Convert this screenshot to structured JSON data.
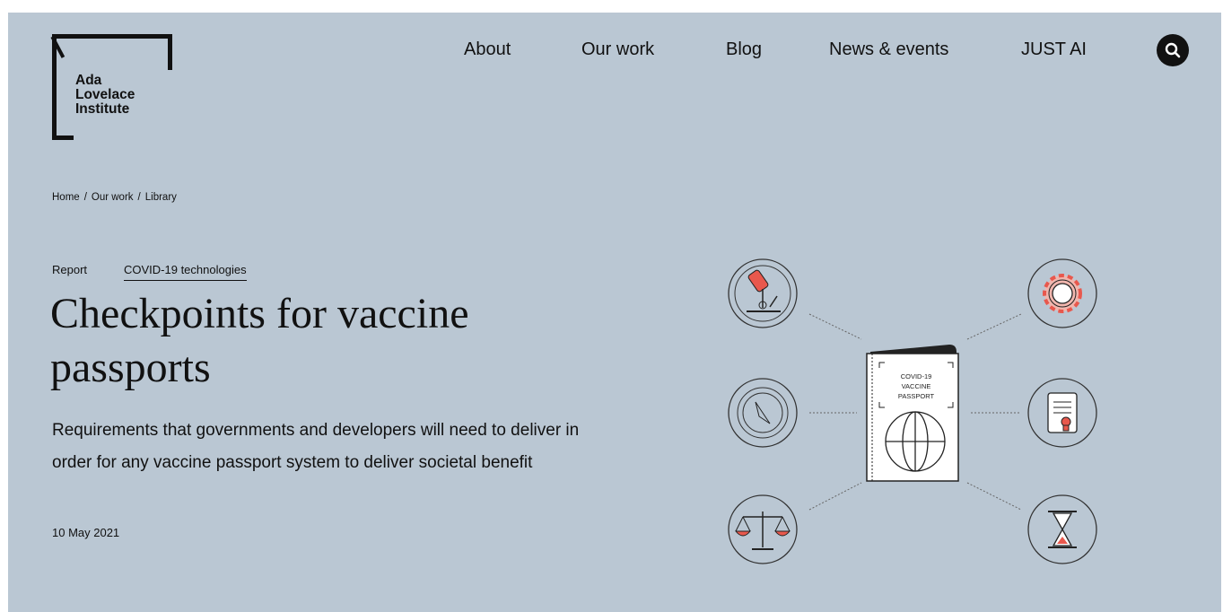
{
  "logo": {
    "lines": [
      "Ada",
      "Lovelace",
      "Institute"
    ]
  },
  "nav": {
    "items": [
      "About",
      "Our work",
      "Blog",
      "News & events",
      "JUST AI"
    ]
  },
  "breadcrumb": [
    "Home",
    "Our work",
    "Library"
  ],
  "article": {
    "type": "Report",
    "tag": "COVID-19 technologies",
    "title_line1": "Checkpoints for vaccine",
    "title_line2": "passports",
    "subtitle": "Requirements that governments and developers will need to deliver in order for any vaccine passport system to deliver societal benefit",
    "date": "10 May 2021"
  },
  "illustration": {
    "passport_lines": [
      "COVID-19",
      "VACCINE",
      "PASSPORT"
    ],
    "icons_left": [
      "microscope-icon",
      "compass-icon",
      "scales-icon"
    ],
    "icons_right": [
      "gear-icon",
      "certificate-icon",
      "hourglass-icon"
    ]
  },
  "colors": {
    "background": "#bac7d3",
    "accent": "#e8584d",
    "ink": "#111111"
  }
}
